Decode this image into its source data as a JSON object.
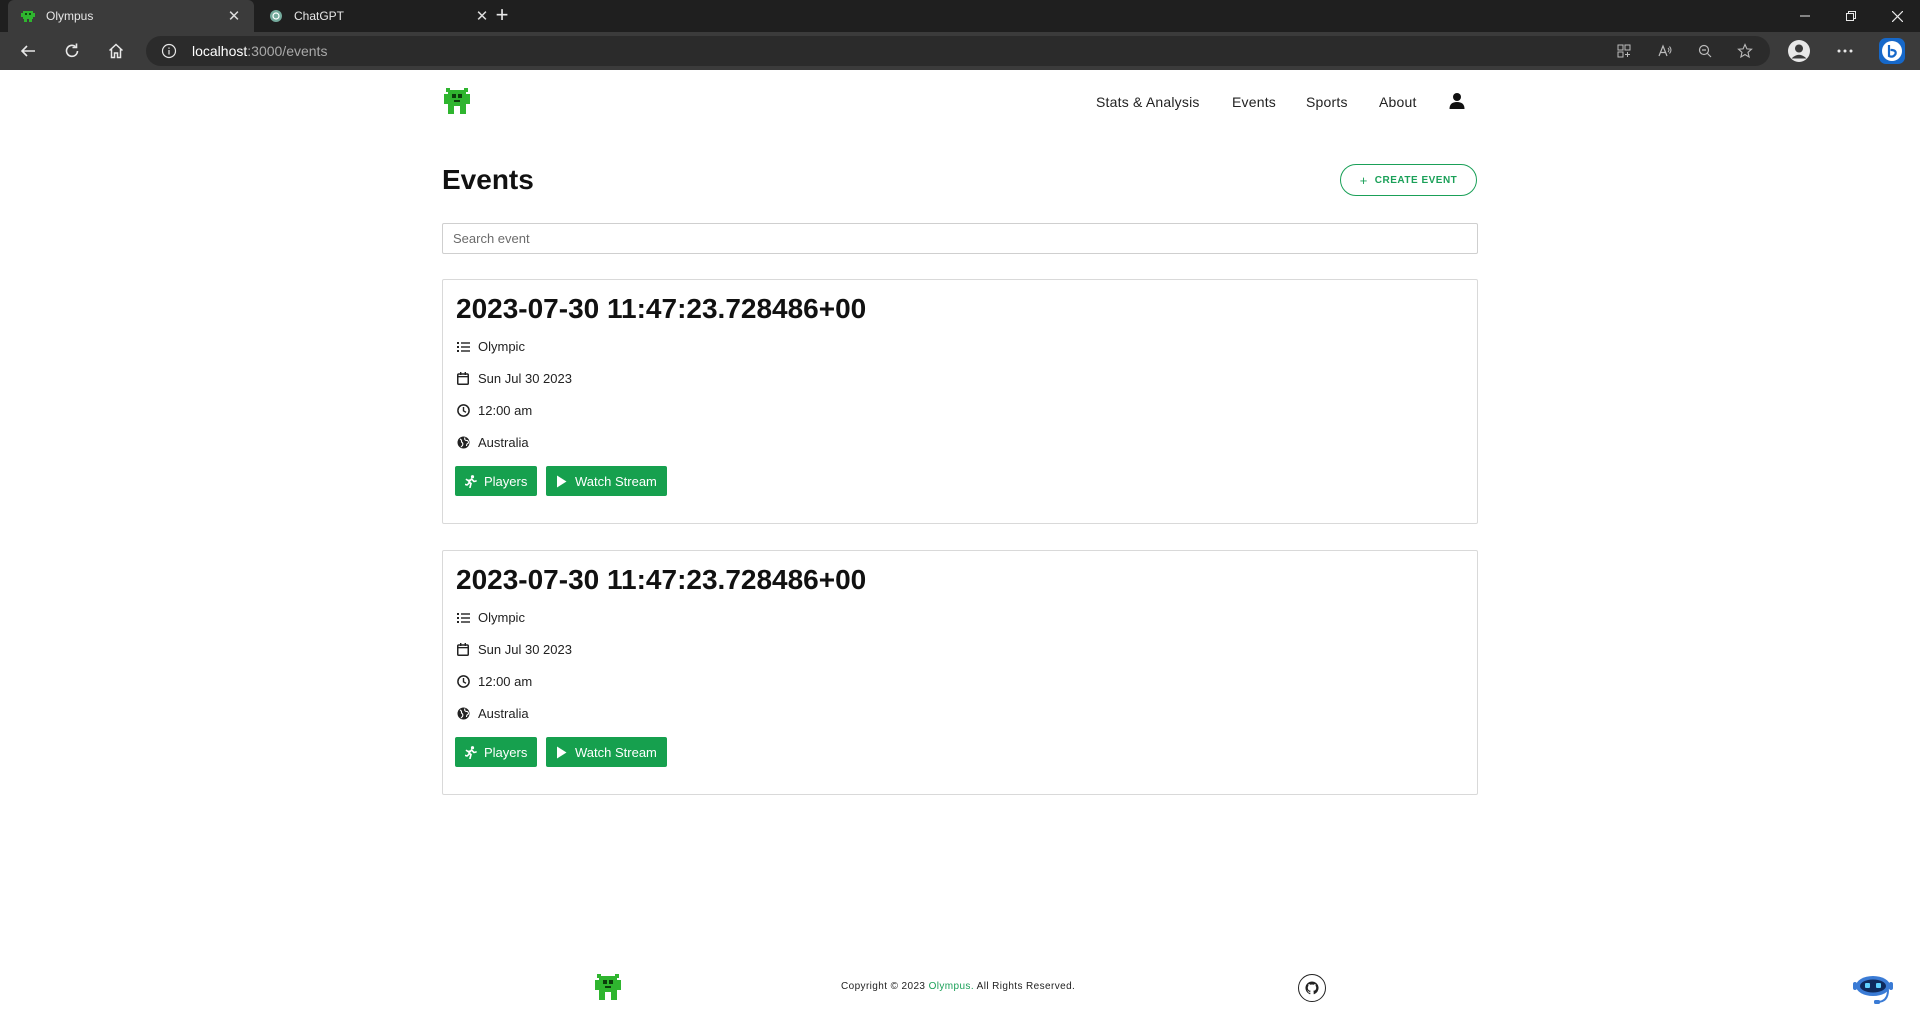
{
  "browser": {
    "tabs": [
      {
        "title": "Olympus",
        "active": true
      },
      {
        "title": "ChatGPT",
        "active": false
      }
    ],
    "url_host": "localhost",
    "url_rest": ":3000/events"
  },
  "nav": {
    "links": [
      "Stats & Analysis",
      "Events",
      "Sports",
      "About"
    ]
  },
  "page": {
    "heading": "Events",
    "create_button": "CREATE EVENT",
    "search_placeholder": "Search event"
  },
  "events": [
    {
      "title": "2023-07-30 11:47:23.728486+00",
      "category": "Olympic",
      "date": "Sun Jul 30 2023",
      "time": "12:00 am",
      "location": "Australia",
      "players_label": "Players",
      "stream_label": "Watch Stream"
    },
    {
      "title": "2023-07-30 11:47:23.728486+00",
      "category": "Olympic",
      "date": "Sun Jul 30 2023",
      "time": "12:00 am",
      "location": "Australia",
      "players_label": "Players",
      "stream_label": "Watch Stream"
    }
  ],
  "footer": {
    "copyright_prefix": "Copyright © 2023 ",
    "brand": "Olympus.",
    "copyright_suffix": " All Rights Reserved."
  },
  "colors": {
    "accent": "#16a04e",
    "logo_green": "#2fb52f"
  }
}
